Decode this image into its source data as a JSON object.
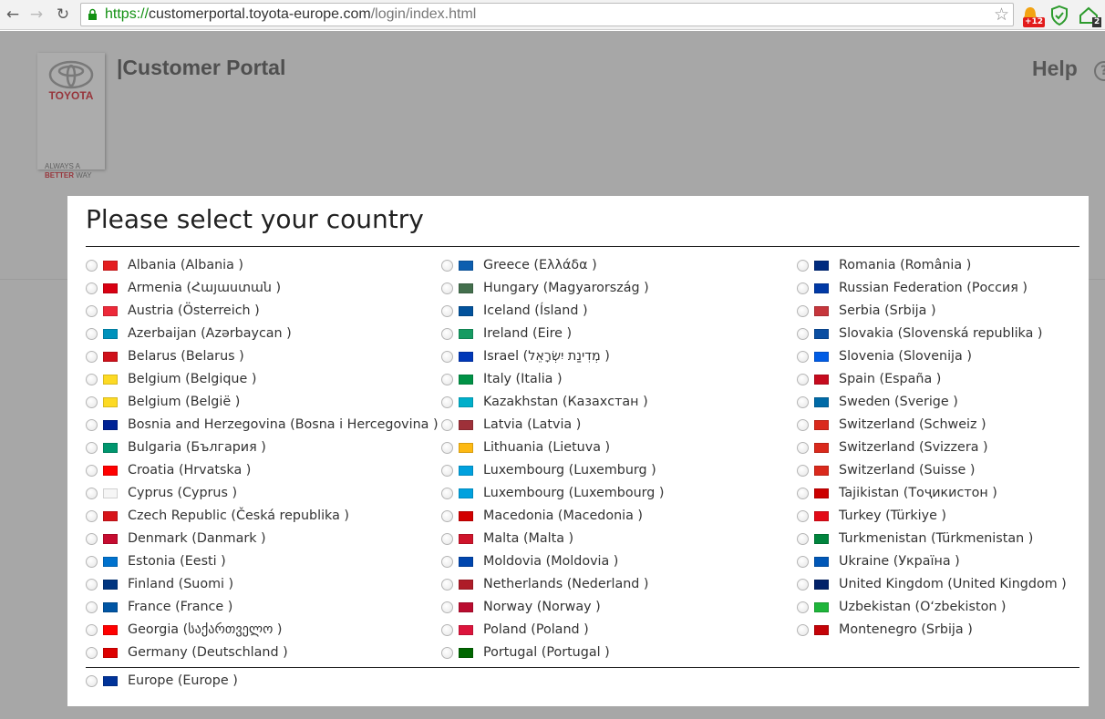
{
  "browser": {
    "url_scheme": "https://",
    "url_host": "customerportal.toyota-europe.com",
    "url_path": "/login/index.html",
    "ext_badge": "+12",
    "ext_count": "2"
  },
  "header": {
    "logo_text": "TOYOTA",
    "tagline_1": "ALWAYS A",
    "tagline_2a": "BETTER",
    "tagline_2b": " WAY",
    "title": "|Customer Portal",
    "help": "Help"
  },
  "modal": {
    "title": "Please select your country",
    "columns": [
      [
        {
          "label": "Albania (Albania )",
          "flag": "#e41e20"
        },
        {
          "label": "Armenia (Հայաստան )",
          "flag": "#d90012"
        },
        {
          "label": "Austria (Österreich )",
          "flag": "#ed2939"
        },
        {
          "label": "Azerbaijan (Azərbaycan )",
          "flag": "#0092bc"
        },
        {
          "label": "Belarus (Belarus )",
          "flag": "#cf101a"
        },
        {
          "label": "Belgium (Belgique )",
          "flag": "#fdda24"
        },
        {
          "label": "Belgium (België )",
          "flag": "#fdda24"
        },
        {
          "label": "Bosnia and Herzegovina (Bosna i Hercegovina )",
          "flag": "#002395"
        },
        {
          "label": "Bulgaria (България )",
          "flag": "#00966e"
        },
        {
          "label": "Croatia (Hrvatska )",
          "flag": "#ff0000"
        },
        {
          "label": "Cyprus (Cyprus )",
          "flag": "#f6f6f6"
        },
        {
          "label": "Czech Republic (Česká republika )",
          "flag": "#d7141a"
        },
        {
          "label": "Denmark (Danmark )",
          "flag": "#c60c30"
        },
        {
          "label": "Estonia (Eesti )",
          "flag": "#0072ce"
        },
        {
          "label": "Finland (Suomi )",
          "flag": "#003580"
        },
        {
          "label": "France (France )",
          "flag": "#0055a4"
        },
        {
          "label": "Georgia (საქართველო )",
          "flag": "#ff0000"
        },
        {
          "label": "Germany (Deutschland )",
          "flag": "#dd0000"
        }
      ],
      [
        {
          "label": "Greece (Ελλάδα )",
          "flag": "#0d5eaf"
        },
        {
          "label": "Hungary (Magyarország )",
          "flag": "#436f4d"
        },
        {
          "label": "Iceland (Ísland )",
          "flag": "#02529c"
        },
        {
          "label": "Ireland (Eire )",
          "flag": "#169b62"
        },
        {
          "label": "Israel (מְדִינַת יִשְׂרָאֵל )",
          "flag": "#0038b8"
        },
        {
          "label": "Italy (Italia )",
          "flag": "#009246"
        },
        {
          "label": "Kazakhstan (Казахстан )",
          "flag": "#00afca"
        },
        {
          "label": "Latvia (Latvia )",
          "flag": "#9e3039"
        },
        {
          "label": "Lithuania (Lietuva )",
          "flag": "#fdb913"
        },
        {
          "label": "Luxembourg (Luxemburg )",
          "flag": "#00a1de"
        },
        {
          "label": "Luxembourg (Luxembourg )",
          "flag": "#00a1de"
        },
        {
          "label": "Macedonia (Macedonia )",
          "flag": "#d20000"
        },
        {
          "label": "Malta (Malta )",
          "flag": "#cf142b"
        },
        {
          "label": "Moldovia (Moldovia )",
          "flag": "#0046ae"
        },
        {
          "label": "Netherlands (Nederland )",
          "flag": "#ae1c28"
        },
        {
          "label": "Norway (Norway )",
          "flag": "#ba0c2f"
        },
        {
          "label": "Poland (Poland )",
          "flag": "#dc143c"
        },
        {
          "label": "Portugal (Portugal )",
          "flag": "#006600"
        }
      ],
      [
        {
          "label": "Romania (România )",
          "flag": "#002b7f"
        },
        {
          "label": "Russian Federation (Россия )",
          "flag": "#0039a6"
        },
        {
          "label": "Serbia (Srbija )",
          "flag": "#c6363c"
        },
        {
          "label": "Slovakia (Slovenská republika )",
          "flag": "#0b4ea2"
        },
        {
          "label": "Slovenia (Slovenija )",
          "flag": "#005ce5"
        },
        {
          "label": "Spain (España )",
          "flag": "#c60b1e"
        },
        {
          "label": "Sweden (Sverige )",
          "flag": "#006aa7"
        },
        {
          "label": "Switzerland (Schweiz )",
          "flag": "#da291c"
        },
        {
          "label": "Switzerland (Svizzera )",
          "flag": "#da291c"
        },
        {
          "label": "Switzerland (Suisse )",
          "flag": "#da291c"
        },
        {
          "label": "Tajikistan (Тоҷикистон )",
          "flag": "#cc0000"
        },
        {
          "label": "Turkey (Türkiye )",
          "flag": "#e30a17"
        },
        {
          "label": "Turkmenistan (Türkmenistan )",
          "flag": "#00843d"
        },
        {
          "label": "Ukraine (Україна )",
          "flag": "#0057b7"
        },
        {
          "label": "United Kingdom (United Kingdom )",
          "flag": "#012169"
        },
        {
          "label": "Uzbekistan (Oʻzbekiston )",
          "flag": "#1eb53a"
        },
        {
          "label": "Montenegro (Srbija )",
          "flag": "#c40308"
        }
      ]
    ],
    "footer_item": {
      "label": "Europe (Europe )",
      "flag": "#003399"
    }
  }
}
